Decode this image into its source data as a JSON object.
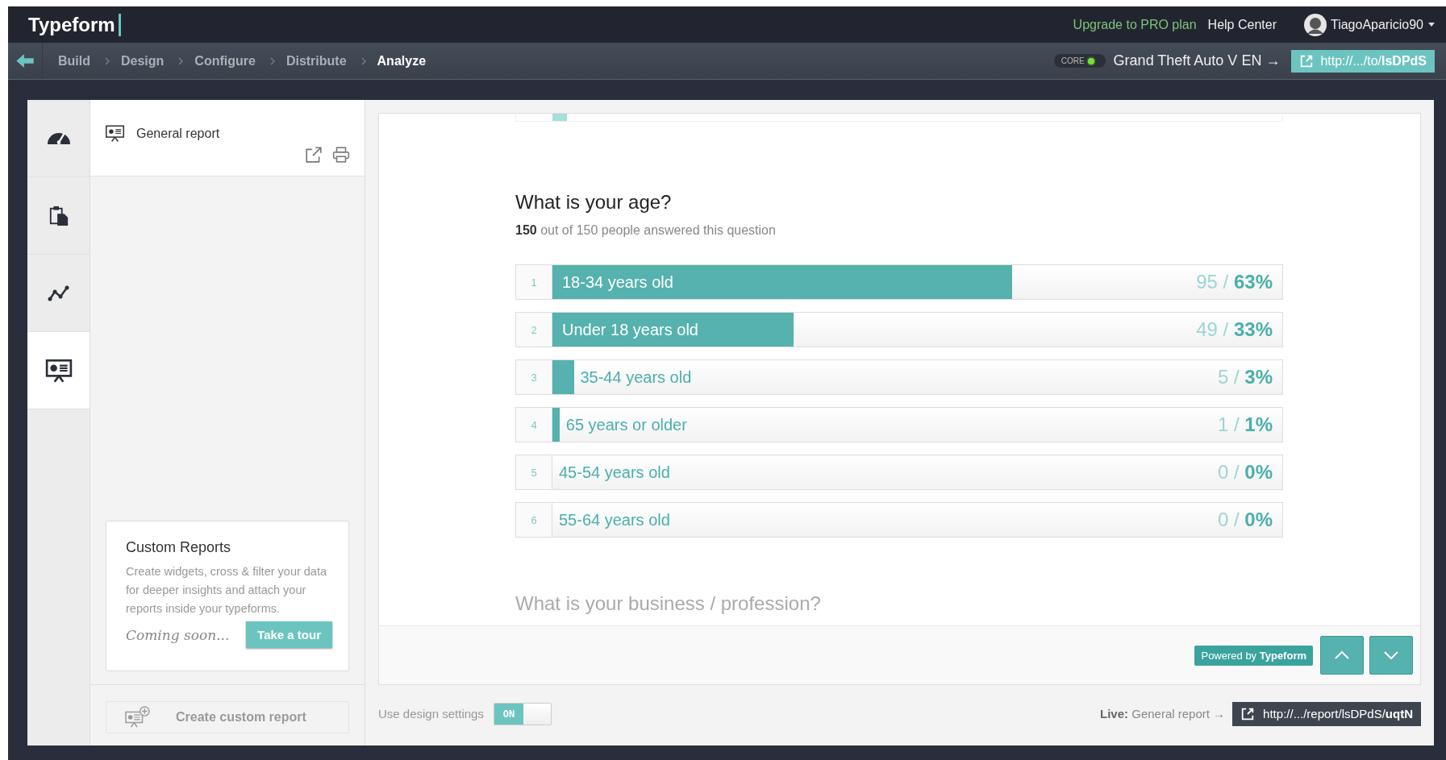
{
  "header": {
    "logo": "Typeform",
    "links": [
      {
        "label": "Upgrade to PRO plan",
        "kind": "upgrade"
      },
      {
        "label": "Help Center",
        "kind": "plain"
      }
    ],
    "user": "TiagoAparicio90"
  },
  "breadcrumbs": [
    {
      "label": "Build",
      "selected": false
    },
    {
      "label": "Design",
      "selected": false
    },
    {
      "label": "Configure",
      "selected": false
    },
    {
      "label": "Distribute",
      "selected": false
    },
    {
      "label": "Analyze",
      "selected": true
    }
  ],
  "form": {
    "badge": "CORE",
    "live": true,
    "title": "Grand Theft Auto V EN →",
    "url": "http://.../to/**lsDPdS**"
  },
  "rail": [
    {
      "kind": "dashboard",
      "selected": false
    },
    {
      "kind": "clipboard",
      "selected": false
    },
    {
      "kind": "chart",
      "selected": false
    },
    {
      "kind": "report",
      "selected": true
    }
  ],
  "report_panel": {
    "title": "General report",
    "custom": {
      "title": "Custom Reports",
      "text": "Create widgets, cross & filter your data for deeper insights and attach your reports inside your typeforms.",
      "note": "Coming soon...",
      "button": "Take a tour"
    },
    "create_button": "Create custom report",
    "create_disabled": true
  },
  "question": {
    "previous_answer": {
      "level": 0.02
    },
    "title": "What is your age?",
    "answered": "**150** out of 150 people answered this question",
    "answers": [
      {
        "index": "1",
        "label": "18-34 years old",
        "count": "95 /",
        "percent": "63%",
        "level": 0.63
      },
      {
        "index": "2",
        "label": "Under 18 years old",
        "count": "49 /",
        "percent": "33%",
        "level": 0.33
      },
      {
        "index": "3",
        "label": "35-44 years old",
        "count": "5 /",
        "percent": "3%",
        "level": 0.03
      },
      {
        "index": "4",
        "label": "65 years or older",
        "count": "1 /",
        "percent": "1%",
        "level": 0.01
      },
      {
        "index": "5",
        "label": "45-54 years old",
        "count": "0 /",
        "percent": "0%"
      },
      {
        "index": "6",
        "label": "55-64 years old",
        "count": "0 /",
        "percent": "0%"
      }
    ],
    "next_title": "What is your business / profession?"
  },
  "card_footer": {
    "powered": "Powered by **Typeform**"
  },
  "design_settings": {
    "label": "Use design settings",
    "on": true,
    "toggle_text": "ON"
  },
  "live": {
    "label": "**Live:** General report →",
    "url": "http://.../report/lsDPdS/**uqtN**"
  }
}
